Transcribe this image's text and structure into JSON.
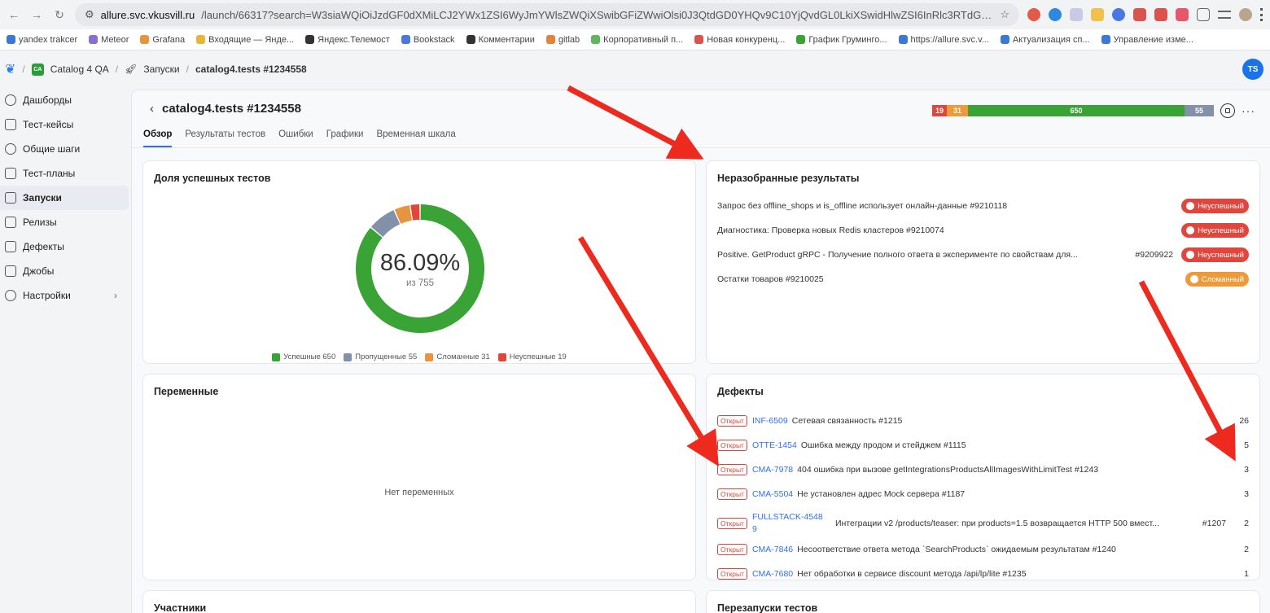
{
  "browser": {
    "url_host": "allure.svc.vkusvill.ru",
    "url_rest": "/launch/66317?search=W3siaWQiOiJzdGF0dXMiLCJ2YWx1ZSI6WyJmYWlsZWQiXSwibGFiZWwiOlsi0J3QtdGD0YHQv9C10YjQvdGL0LkiXSwidHlwZSI6InRlc3RTdGF0d...",
    "bookmarks": [
      "yandex trakcer",
      "Meteor",
      "Grafana",
      "Входящие — Янде...",
      "Яндекс.Телемост",
      "Bookstack",
      "Комментарии",
      "gitlab",
      "Корпоративный п...",
      "Новая конкуренц...",
      "График Груминго...",
      "https://allure.svc.v...",
      "Актуализация сп...",
      "Управление изме..."
    ]
  },
  "header": {
    "project_badge": "CA",
    "project": "Catalog 4 QA",
    "section": "Запуски",
    "current": "catalog4.tests #1234558",
    "avatar": "TS"
  },
  "sidebar": {
    "items": [
      {
        "label": "Дашборды",
        "icon": "dashboard-icon"
      },
      {
        "label": "Тест-кейсы",
        "icon": "code-icon"
      },
      {
        "label": "Общие шаги",
        "icon": "shared-steps-icon"
      },
      {
        "label": "Тест-планы",
        "icon": "clipboard-icon"
      },
      {
        "label": "Запуски",
        "icon": "rocket-icon"
      },
      {
        "label": "Релизы",
        "icon": "box-icon"
      },
      {
        "label": "Дефекты",
        "icon": "bug-icon"
      },
      {
        "label": "Джобы",
        "icon": "terminal-icon"
      },
      {
        "label": "Настройки",
        "icon": "gear-icon"
      }
    ]
  },
  "launch": {
    "title": "catalog4.tests #1234558",
    "tabs": [
      "Обзор",
      "Результаты тестов",
      "Ошибки",
      "Графики",
      "Временная шкала"
    ],
    "stats": {
      "failed": "19",
      "broken": "31",
      "passed": "650",
      "skipped": "55"
    }
  },
  "success_card": {
    "title": "Доля успешных тестов",
    "percent": "86.09%",
    "total": "из 755",
    "legend": [
      {
        "label": "Успешные 650",
        "color": "#3aa335"
      },
      {
        "label": "Пропущенные 55",
        "color": "#8390aa"
      },
      {
        "label": "Сломанные 31",
        "color": "#e8933d"
      },
      {
        "label": "Неуспешные 19",
        "color": "#e2453b"
      }
    ]
  },
  "chart_data": {
    "type": "pie",
    "categories": [
      "Успешные",
      "Пропущенные",
      "Сломанные",
      "Неуспешные"
    ],
    "values": [
      650,
      55,
      31,
      19
    ],
    "colors": [
      "#3aa335",
      "#8390aa",
      "#e8933d",
      "#e2453b"
    ],
    "title": "Доля успешных тестов"
  },
  "unresolved": {
    "title": "Неразобранные результаты",
    "rows": [
      {
        "text": "Запрос без offline_shops и is_offline использует онлайн-данные #9210118",
        "id": "",
        "status": "Неуспешный",
        "color": "#e2453b"
      },
      {
        "text": "Диагностика: Проверка новых Redis кластеров #9210074",
        "id": "",
        "status": "Неуспешный",
        "color": "#e2453b"
      },
      {
        "text": "Positive. GetProduct gRPC - Получение полного ответа в эксперименте по свойствам для...",
        "id": "#9209922",
        "status": "Неуспешный",
        "color": "#e2453b"
      },
      {
        "text": "Остатки товаров #9210025",
        "id": "",
        "status": "Сломанный",
        "color": "#ee9a3a"
      }
    ]
  },
  "variables": {
    "title": "Переменные",
    "empty": "Нет переменных"
  },
  "defects": {
    "title": "Дефекты",
    "open_label": "Открыт",
    "rows": [
      {
        "key": "INF-6509",
        "text": "Сетевая связанность #1215",
        "id": "",
        "count": "26"
      },
      {
        "key": "OTTE-1454",
        "text": "Ошибка между продом и стейджем #1115",
        "id": "",
        "count": "5"
      },
      {
        "key": "CMA-7978",
        "text": "404 ошибка при вызове getIntegrationsProductsAllImagesWithLimitTest #1243",
        "id": "",
        "count": "3"
      },
      {
        "key": "CMA-5504",
        "text": "Не установлен адрес Mock сервера #1187",
        "id": "",
        "count": "3"
      },
      {
        "key": "FULLSTACK-45489",
        "text": "Интеграции v2 /products/teaser: при products=1.5 возвращается HTTP 500 вмест...",
        "id": "#1207",
        "count": "2"
      },
      {
        "key": "CMA-7846",
        "text": "Несоответствие ответа метода `SearchProducts` ожидаемым результатам #1240",
        "id": "",
        "count": "2"
      },
      {
        "key": "CMA-7680",
        "text": "Нет обработки в сервисе discount метода /api/lp/lite #1235",
        "id": "",
        "count": "1"
      }
    ]
  },
  "participants": {
    "title": "Участники"
  },
  "reruns": {
    "title": "Перезапуски тестов"
  }
}
